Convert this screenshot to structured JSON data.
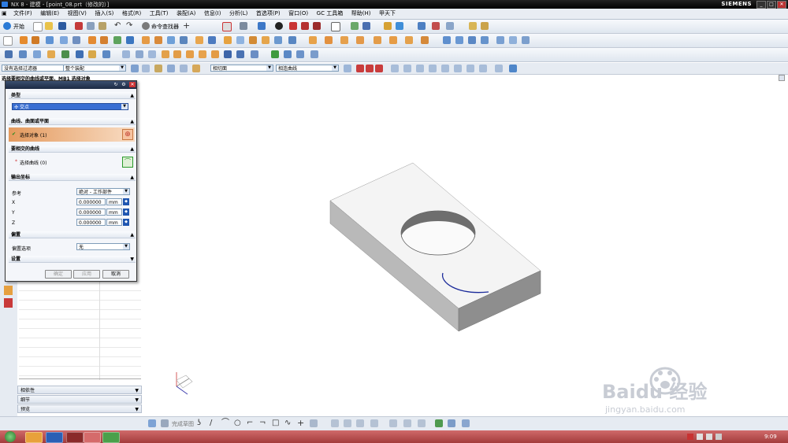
{
  "window": {
    "title": "NX 8 - 建模 - [point_08.prt（修改的）]",
    "brand": "SIEMENS",
    "controls": [
      "_",
      "□",
      "✕"
    ]
  },
  "menubar": [
    "文件(F)",
    "编辑(E)",
    "视图(V)",
    "插入(S)",
    "格式(R)",
    "工具(T)",
    "装配(A)",
    "信息(I)",
    "分析(L)",
    "首选项(P)",
    "窗口(O)",
    "GC 工具箱",
    "帮助(H)",
    "甲天下"
  ],
  "toolbar": {
    "start_label": "开始",
    "command_finder_label": "命令查找器"
  },
  "filterbar": {
    "type_filter": "没有选择过滤器",
    "scope": "整个装配",
    "snap_face": "相切面",
    "snap_curve": "相连曲线"
  },
  "hint": "选择要相交的曲线或平面，MB1 选择对象",
  "dialog": {
    "type_header": "类型",
    "type_value": "交点",
    "curve_header": "曲线、曲面或平面",
    "select_object": "选择对象 (1)",
    "intersect_header": "要相交的曲线",
    "select_curve": "选择曲线 (0)",
    "output_header": "输出坐标",
    "reference_label": "参考",
    "reference_value": "绝对 - 工作部件",
    "x_label": "X",
    "x_value": "0.000000",
    "y_label": "Y",
    "y_value": "0.000000",
    "z_label": "Z",
    "z_value": "0.000000",
    "unit": "mm",
    "offset_header": "偏置",
    "offset_label": "偏置选项",
    "offset_value": "无",
    "settings_header": "设置",
    "ok": "确定",
    "apply": "应用",
    "cancel": "取消"
  },
  "nav_sections": [
    "相依性",
    "细节",
    "预览"
  ],
  "bottombar": {
    "sketch_label": "完成草图"
  },
  "taskbar": {
    "clock": "9:09"
  },
  "watermark": {
    "brand": "Baidu 经验",
    "url": "jingyan.baidu.com"
  },
  "colors": {
    "accent": "#e69a5f",
    "select_green": "#2a9a2a",
    "curve_blue": "#1a2a9a",
    "taskbar": "#b84b4b"
  }
}
